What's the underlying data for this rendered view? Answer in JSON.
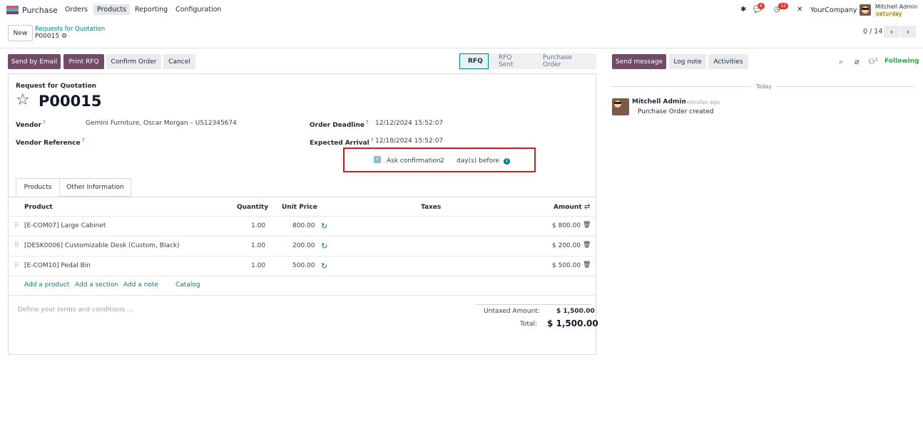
{
  "navbar": {
    "app_name": "Purchase",
    "menu": [
      "Orders",
      "Products",
      "Reporting",
      "Configuration"
    ],
    "active_menu": "Products",
    "messages_count": "6",
    "activities_count": "12",
    "company": "YourCompany",
    "user_name": "Mitchell Admin",
    "db_name": "saturday"
  },
  "control": {
    "new_label": "New",
    "breadcrumb": "Requests for Quotation",
    "record": "P00015",
    "pager": "0 / 14"
  },
  "statusbar": {
    "buttons": [
      "Send by Email",
      "Print RFQ",
      "Confirm Order",
      "Cancel"
    ],
    "stages": [
      "RFQ",
      "RFQ Sent",
      "Purchase Order"
    ],
    "current_stage": "RFQ"
  },
  "form": {
    "doc_type": "Request for Quotation",
    "title": "P00015",
    "vendor_label": "Vendor",
    "vendor_value": "Gemini Furniture, Oscar Morgan – US12345674",
    "vendor_ref_label": "Vendor Reference",
    "order_deadline_label": "Order Deadline",
    "order_deadline_value": "12/12/2024 15:52:07",
    "expected_arrival_label": "Expected Arrival",
    "expected_arrival_value": "12/18/2024 15:52:07",
    "ask_confirmation_label": "Ask confirmation",
    "ask_confirmation_days": "2",
    "days_before_label": "day(s) before",
    "help_marker": "?"
  },
  "tabs": [
    "Products",
    "Other Information"
  ],
  "table": {
    "headers": [
      "Product",
      "Quantity",
      "Unit Price",
      "Taxes",
      "Amount"
    ],
    "rows": [
      {
        "product": "[E-COM07] Large Cabinet",
        "qty": "1.00",
        "price": "800.00",
        "taxes": "",
        "amount": "$ 800.00"
      },
      {
        "product": "[DESK0006] Customizable Desk (Custom, Black)",
        "qty": "1.00",
        "price": "200.00",
        "taxes": "",
        "amount": "$ 200.00"
      },
      {
        "product": "[E-COM10] Pedal Bin",
        "qty": "1.00",
        "price": "500.00",
        "taxes": "",
        "amount": "$ 500.00"
      }
    ],
    "add_links": [
      "Add a product",
      "Add a section",
      "Add a note",
      "Catalog"
    ]
  },
  "footer": {
    "terms_placeholder": "Define your terms and conditions ...",
    "untaxed_label": "Untaxed Amount:",
    "untaxed_value": "$ 1,500.00",
    "total_label": "Total:",
    "total_value": "$ 1,500.00"
  },
  "chatter": {
    "buttons": [
      "Send message",
      "Log note",
      "Activities"
    ],
    "followers_count": "1",
    "following_label": "Following",
    "today_label": "Today",
    "author": "Mitchell Admin",
    "time": "- 2 minutes ago",
    "body": "Purchase Order created"
  },
  "colors": {
    "brand": "#714b67",
    "accent": "#017e84",
    "highlight_box": "#d61a1a",
    "following": "#28a745"
  }
}
